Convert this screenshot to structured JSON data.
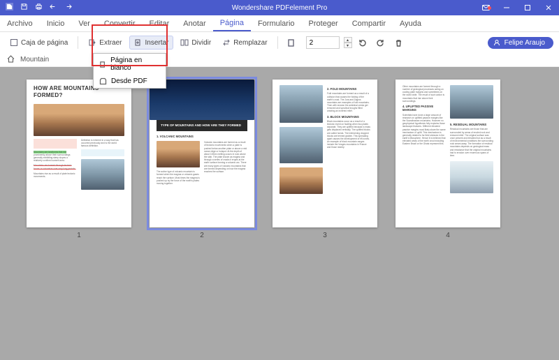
{
  "app": {
    "title": "Wondershare PDFelement Pro"
  },
  "menu": {
    "items": [
      "Archivo",
      "Inicio",
      "Ver",
      "Convertir",
      "Editar",
      "Anotar",
      "Página",
      "Formulario",
      "Proteger",
      "Compartir",
      "Ayuda"
    ],
    "active": "Página"
  },
  "toolbar": {
    "pagebox": "Caja de página",
    "extract": "Extraer",
    "insert": "Insertar",
    "split": "Dividir",
    "replace": "Remplazar",
    "pagefield": "2"
  },
  "insert_menu": {
    "blank": "Página en blanco",
    "frompdf": "Desde PDF"
  },
  "user": {
    "name": "Felipe Araujo"
  },
  "breadcrumb": {
    "doc": "Mountain"
  },
  "pages": {
    "p1": {
      "num": "1",
      "title": "HOW ARE MOUNTAINS FORMED?"
    },
    "p2": {
      "num": "2",
      "band": "TYPE OF MOUNTAINS AND HOW ARE THEY FORMED",
      "h": "1. VOLCANIC MOUNTAINS"
    },
    "p3": {
      "num": "3",
      "h1": "2. FOLD MOUNTAINS",
      "h2": "3. BLOCK MOUNTAINS"
    },
    "p4": {
      "num": "4",
      "h1": "4. UPLIFTED PASSIVE MARGINS",
      "h2": "5. RESIDUAL MOUNTAINS"
    }
  }
}
